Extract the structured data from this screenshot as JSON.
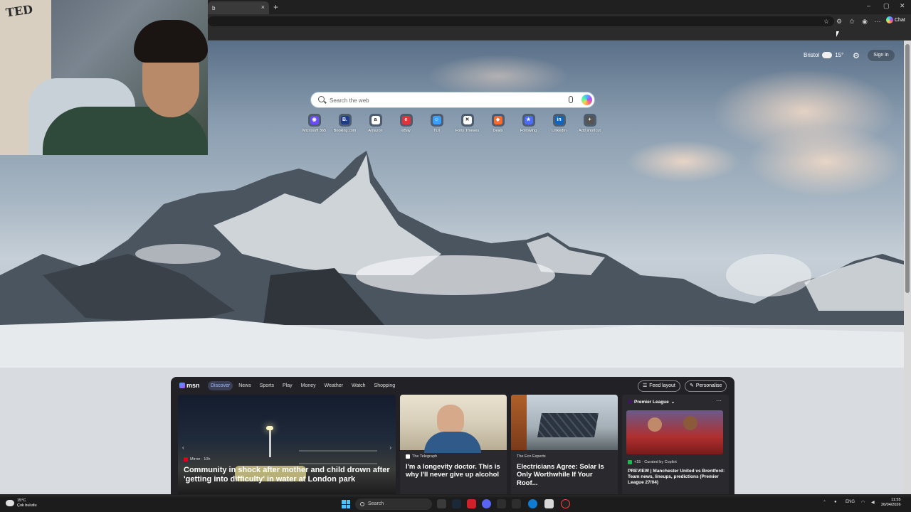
{
  "browser": {
    "tab_title": "b",
    "tab_close": "×",
    "new_tab": "+",
    "chat_label": "Chat",
    "window_controls": [
      "–",
      "▢",
      "✕"
    ]
  },
  "webcam": {
    "poster_text": "TED"
  },
  "weather": {
    "city": "Bristol",
    "temp": "15°"
  },
  "header": {
    "signin_label": "Sign in"
  },
  "search": {
    "placeholder": "Search the web"
  },
  "shortcuts": [
    {
      "label": "Microsoft 365",
      "glyph": "◉",
      "color": "#6b4dff"
    },
    {
      "label": "Booking.com",
      "glyph": "B.",
      "color": "#1e3a8a"
    },
    {
      "label": "Amazon",
      "glyph": "a",
      "color": "#ffffff"
    },
    {
      "label": "eBay",
      "glyph": "e",
      "color": "#e53238"
    },
    {
      "label": "TUI",
      "glyph": "☺",
      "color": "#3aa0ff"
    },
    {
      "label": "Forty Thieves",
      "glyph": "✕",
      "color": "#ffffff"
    },
    {
      "label": "Deals",
      "glyph": "◆",
      "color": "#ff6a2a"
    },
    {
      "label": "Following",
      "glyph": "★",
      "color": "#4d6bff"
    },
    {
      "label": "LinkedIn",
      "glyph": "in",
      "color": "#0a66c2"
    },
    {
      "label": "Add shortcut",
      "glyph": "+",
      "color": "#555555"
    }
  ],
  "msn": {
    "logo": "msn",
    "nav": [
      "Discover",
      "News",
      "Sports",
      "Play",
      "Money",
      "Weather",
      "Watch",
      "Shopping"
    ],
    "feed_layout": "Feed layout",
    "personalise": "Personalise",
    "cards": [
      {
        "source": "Mirror · 10h",
        "title": "Community in shock after mother and child drown after 'getting into difficulty' in water at London park"
      },
      {
        "source": "The Telegraph",
        "title": "I'm a longevity doctor. This is why I'll never give up alcohol"
      },
      {
        "source": "The Eco Experts",
        "title": "Electricians Agree: Solar Is Only Worthwhile If Your Roof..."
      },
      {
        "header": "Premier League",
        "source": "+15 · Curated by Copilot",
        "title": "PREVIEW | Manchester United vs Brentford: Team news, lineups, predictions (Premier League 27/04)"
      }
    ]
  },
  "taskbar": {
    "weather_temp": "15°C",
    "weather_desc": "Çok bulutlu",
    "search_label": "Search",
    "lang": "ENG",
    "time": "11:55",
    "date": "26/04/2026"
  },
  "colors": {
    "accent": "#4cc2ff",
    "msn_panel": "#1c1c20"
  }
}
